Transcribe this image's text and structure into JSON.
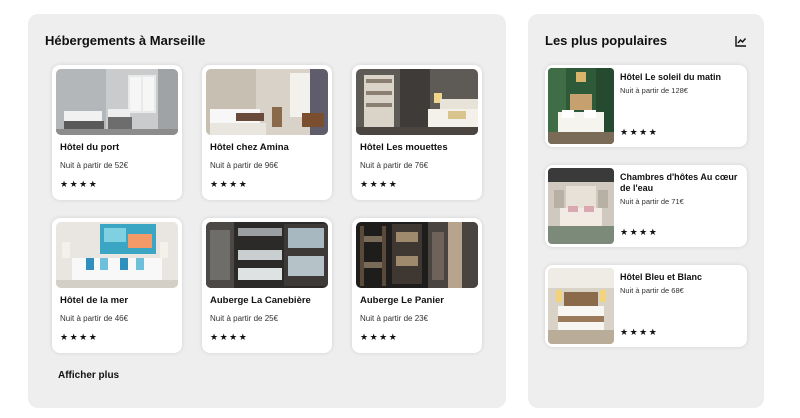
{
  "main": {
    "title": "Hébergements à Marseille",
    "show_more_label": "Afficher plus",
    "cards": [
      {
        "name": "Hôtel du port",
        "price": "Nuit à partir de 52€",
        "rating": 4,
        "stars": "★★★★"
      },
      {
        "name": "Hôtel chez Amina",
        "price": "Nuit à partir de 96€",
        "rating": 4,
        "stars": "★★★★"
      },
      {
        "name": "Hôtel Les mouettes",
        "price": "Nuit à partir de 76€",
        "rating": 4,
        "stars": "★★★★"
      },
      {
        "name": "Hôtel de la mer",
        "price": "Nuit à partir de 46€",
        "rating": 4,
        "stars": "★★★★"
      },
      {
        "name": "Auberge La Canebière",
        "price": "Nuit à partir de 25€",
        "rating": 4,
        "stars": "★★★★"
      },
      {
        "name": "Auberge Le Panier",
        "price": "Nuit à partir de 23€",
        "rating": 4,
        "stars": "★★★★"
      }
    ]
  },
  "side": {
    "title": "Les plus populaires",
    "icon": "trending-chart-icon",
    "cards": [
      {
        "name": "Hôtel Le soleil du matin",
        "price": "Nuit à partir de 128€",
        "rating": 4,
        "stars": "★★★★"
      },
      {
        "name": "Chambres d'hôtes Au cœur de l'eau",
        "price": "Nuit à partir de 71€",
        "rating": 4,
        "stars": "★★★★"
      },
      {
        "name": "Hôtel Bleu et Blanc",
        "price": "Nuit à partir de 68€",
        "rating": 4,
        "stars": "★★★★"
      }
    ]
  },
  "colors": {
    "panel_bg": "#eeeeee",
    "card_bg": "#ffffff",
    "text": "#111111"
  }
}
